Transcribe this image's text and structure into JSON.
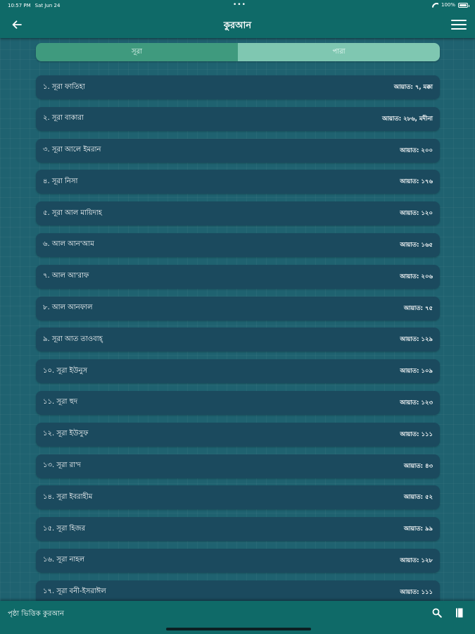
{
  "status_bar": {
    "time": "10:57 PM",
    "date": "Sat Jun 24",
    "dots": "•••",
    "battery": "100%"
  },
  "nav": {
    "title": "কুরআন",
    "back_icon": "arrow-left-icon",
    "menu_icon": "hamburger-menu-icon"
  },
  "tabs": [
    {
      "label": "সূরা",
      "active": true
    },
    {
      "label": "পারা",
      "active": false
    }
  ],
  "surahs": [
    {
      "name": "১. সূরা ফাতিহা",
      "ayat": "আয়াত: ৭, মক্কা"
    },
    {
      "name": "২. সূরা বাকারা",
      "ayat": "আয়াত: ২৮৬, মদীনা"
    },
    {
      "name": "৩. সূরা আলে ইমরান",
      "ayat": "আয়াত: ২০০"
    },
    {
      "name": "৪. সূরা নিসা",
      "ayat": "আয়াত: ১৭৬"
    },
    {
      "name": "৫. সূরা আল মায়িদাহ",
      "ayat": "আয়াত: ১২০"
    },
    {
      "name": "৬. আল আন'আম",
      "ayat": "আয়াত: ১৬৫"
    },
    {
      "name": "৭. আল আ'রাফ",
      "ayat": "আয়াত: ২০৬"
    },
    {
      "name": "৮. আল আনফাল",
      "ayat": "আয়াত: ৭৫"
    },
    {
      "name": "৯. সূরা আত তাওবাহ্",
      "ayat": "আয়াত: ১২৯"
    },
    {
      "name": "১০. সূরা ইউনুস",
      "ayat": "আয়াত: ১০৯"
    },
    {
      "name": "১১. সূরা হুদ",
      "ayat": "আয়াত: ১২৩"
    },
    {
      "name": "১২. সূরা ইউসুফ",
      "ayat": "আয়াত: ১১১"
    },
    {
      "name": "১৩. সূরা রা'দ",
      "ayat": "আয়াত: ৪৩"
    },
    {
      "name": "১৪. সূরা ইবরাহীম",
      "ayat": "আয়াত: ৫২"
    },
    {
      "name": "১৫. সূরা হিজর",
      "ayat": "আয়াত: ৯৯"
    },
    {
      "name": "১৬. সূরা নাহল",
      "ayat": "আয়াত: ১২৮"
    },
    {
      "name": "১৭. সূরা বনী-ইসরাঈল",
      "ayat": "আয়াত: ১১১"
    }
  ],
  "bottom_bar": {
    "label": "পৃষ্ঠা ভিত্তিক কুরআন",
    "search_icon": "search-icon",
    "bookmark_icon": "book-icon"
  },
  "colors": {
    "bar": "#0f6a68",
    "background": "#1f6270",
    "row": "#1b4a5e",
    "tab_active": "#3f9a7e",
    "tab_inactive": "#7fc7b1"
  }
}
